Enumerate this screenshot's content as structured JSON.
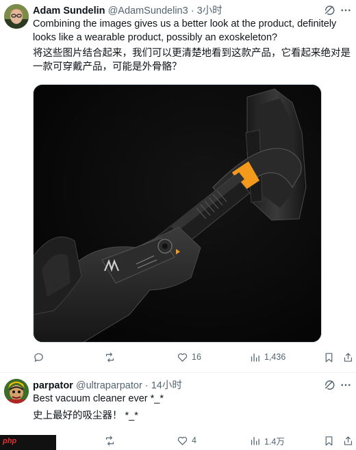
{
  "tweets": [
    {
      "author_name": "Adam Sundelin",
      "handle": "@AdamSundelin3",
      "separator": "·",
      "time": "3小时",
      "text_en": "Combining the images gives us a better look at the product, definitely looks like a wearable product, possibly an exoskeleton?",
      "text_zh": "将这些图片结合起来，我们可以更清楚地看到这款产品，它看起来绝对是一款可穿戴产品，可能是外骨骼？",
      "has_media": true,
      "media_icon": "exoskeleton-product-photo",
      "actions": {
        "reply_count": "",
        "retweet_count": "",
        "like_count": "16",
        "view_count": "1,436"
      }
    },
    {
      "author_name": "parpator",
      "handle": "@ultraparpator",
      "separator": "·",
      "time": "14小时",
      "text_en": "Best vacuum cleaner ever *_*",
      "text_zh": "史上最好的吸尘器！ *_*",
      "has_media": false,
      "actions": {
        "reply_count": "",
        "retweet_count": "",
        "like_count": "4",
        "view_count": "1.4万"
      }
    }
  ],
  "watermark": {
    "text": "php"
  },
  "colors": {
    "text_primary": "#0f1419",
    "text_secondary": "#536471",
    "divider": "#eff3f4",
    "accent_orange": "#f39a1c"
  }
}
